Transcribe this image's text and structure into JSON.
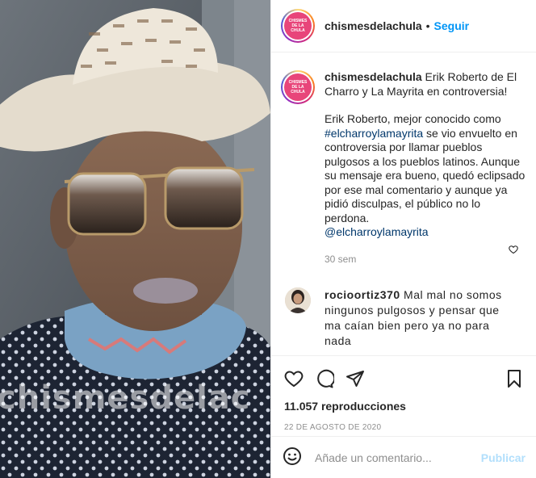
{
  "header": {
    "username": "chismesdelachula",
    "separator": "•",
    "follow_label": "Seguir"
  },
  "avatar": {
    "line1": "CHISMES",
    "line2": "DE LA",
    "line3": "CHULA",
    "color": "#e8457a"
  },
  "caption": {
    "username": "chismesdelachula",
    "title": "Erik Roberto de El Charro y La Mayrita en controversia!",
    "body_before": "Erik Roberto, mejor conocido como ",
    "hashtag": "#elcharroylamayrita",
    "body_after": " se vio envuelto en controversia por llamar pueblos pulgosos a los pueblos latinos. Aunque su mensaje era bueno, quedó eclipsado por ese mal comentario y aunque ya pidió disculpas, el público no lo perdona.",
    "mention": "@elcharroylamayrita",
    "age": "30 sem"
  },
  "comment": {
    "username": "rocioortiz370",
    "text": "Mal mal no somos ningunos pulgosos y pensar que ma caían bien pero ya no para nada"
  },
  "stats": {
    "views": "11.057 reproducciones",
    "date": "22 DE AGOSTO DE 2020"
  },
  "composer": {
    "placeholder": "Añade un comentario...",
    "publish_label": "Publicar"
  },
  "media": {
    "watermark": "chismesdelac"
  },
  "colors": {
    "link": "#00376b",
    "accent": "#0095f6",
    "muted": "#8e8e8e"
  }
}
